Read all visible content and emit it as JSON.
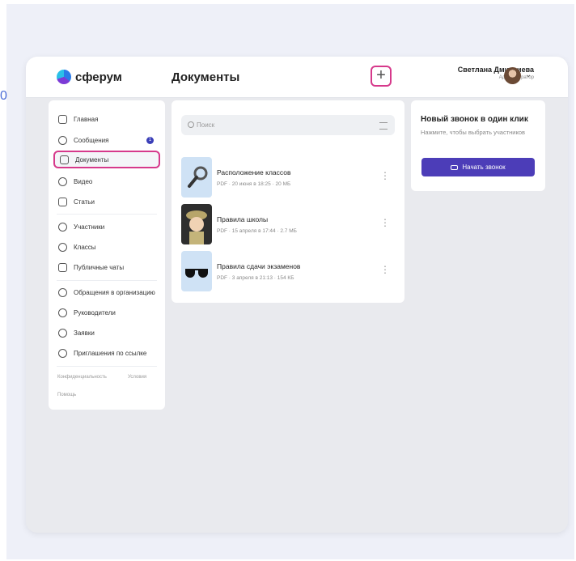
{
  "stray": "0",
  "app": {
    "logo": "сферум",
    "page_title": "Документы",
    "add_label": "+"
  },
  "user": {
    "name": "Светлана Дмитриева",
    "role": "Администратор"
  },
  "sidebar": {
    "items": [
      {
        "label": "Главная",
        "icon": "home-icon"
      },
      {
        "label": "Сообщения",
        "icon": "chat-icon",
        "badge": "1"
      },
      {
        "label": "Документы",
        "icon": "document-icon",
        "active": true
      },
      {
        "label": "Видео",
        "icon": "video-icon"
      },
      {
        "label": "Статьи",
        "icon": "article-icon"
      },
      {
        "label": "Участники",
        "icon": "members-icon"
      },
      {
        "label": "Классы",
        "icon": "classes-icon"
      },
      {
        "label": "Публичные чаты",
        "icon": "public-chats-icon"
      },
      {
        "label": "Обращения в организацию",
        "icon": "appeals-icon"
      },
      {
        "label": "Руководители",
        "icon": "managers-icon"
      },
      {
        "label": "Заявки",
        "icon": "requests-icon"
      },
      {
        "label": "Приглашения по ссылке",
        "icon": "invite-link-icon"
      }
    ],
    "footer": {
      "privacy": "Конфиденциальность",
      "terms": "Условия",
      "help": "Помощь"
    }
  },
  "search": {
    "placeholder": "Поиск"
  },
  "documents": [
    {
      "name": "Расположение классов",
      "meta": "PDF · 20 июня в 18:25 · 20 МБ",
      "thumb": "magnifier"
    },
    {
      "name": "Правила школы",
      "meta": "PDF · 15 апреля в 17:44 · 2.7 МБ",
      "thumb": "explorer"
    },
    {
      "name": "Правила сдачи экзаменов",
      "meta": "PDF · 3 апреля в 21:13 · 154 КБ",
      "thumb": "sunglasses"
    }
  ],
  "call": {
    "title": "Новый звонок в один клик",
    "subtitle": "Нажмите, чтобы выбрать участников",
    "button": "Начать звонок"
  },
  "colors": {
    "accent": "#4c3db8",
    "highlight": "#d6398b",
    "background": "#e9eaee"
  }
}
